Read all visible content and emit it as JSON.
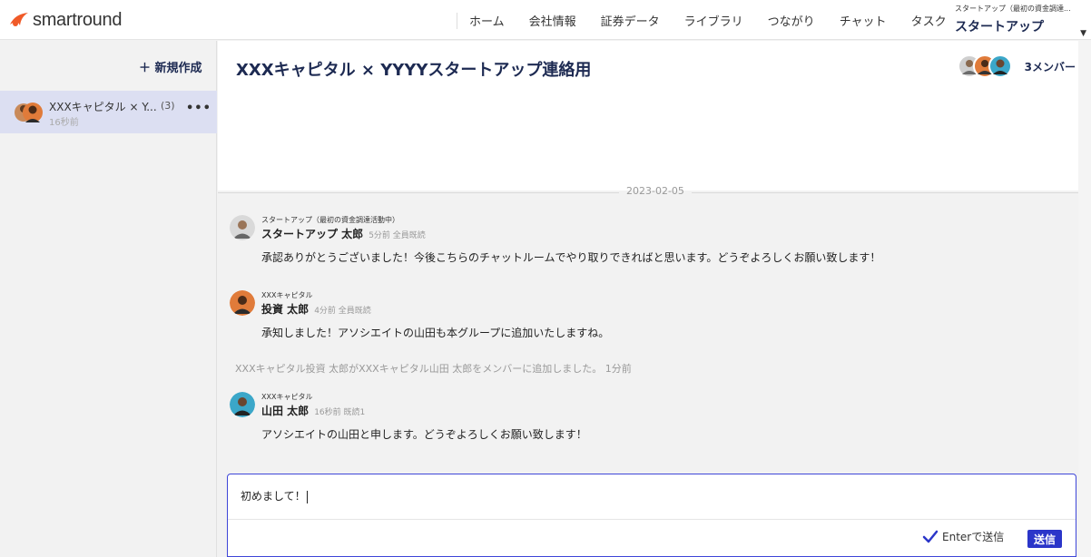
{
  "app": {
    "brand": "smartround",
    "brand_color": "#f05a28",
    "accent_color": "#1d2a52",
    "primary_button_color": "#2b36c9"
  },
  "nav": {
    "items": [
      "ホーム",
      "会社情報",
      "証券データ",
      "ライブラリ",
      "つながり",
      "チャット",
      "タスク"
    ]
  },
  "org_switcher": {
    "subtitle": "スタートアップ（最初の資金調達...",
    "name": "スタートアップ ...",
    "caret_icon": "caret-down-icon"
  },
  "sidebar": {
    "new_label": "新規作成",
    "plus_icon": "plus-icon",
    "rooms": [
      {
        "name": "XXXキャピタル × Y...",
        "count": "(3)",
        "time": "16秒前",
        "more": "•••"
      }
    ]
  },
  "room": {
    "title": "XXXキャピタル × YYYYスタートアップ連絡用",
    "members_label": "3メンバー"
  },
  "messages": {
    "date": "2023-02-05",
    "list": [
      {
        "org": "スタートアップ（最初の資金調達活動中）",
        "sender": "スタートアップ 太郎",
        "meta": "5分前 全員既読",
        "text": "承認ありがとうございました！今後こちらのチャットルームでやり取りできればと思います。どうぞよろしくお願い致します！"
      },
      {
        "org": "XXXキャピタル",
        "sender": "投資 太郎",
        "meta": "4分前 全員既読",
        "text": "承知しました！アソシエイトの山田も本グループに追加いたしますね。"
      },
      {
        "org": "XXXキャピタル",
        "sender": "山田 太郎",
        "meta": "16秒前 既読1",
        "text": "アソシエイトの山田と申します。どうぞよろしくお願い致します！"
      }
    ],
    "system": "XXXキャピタル投資 太郎がXXXキャピタル山田 太郎をメンバーに追加しました。 1分前"
  },
  "composer": {
    "value": "初めまして！",
    "enter_to_send_label": "Enterで送信",
    "enter_to_send_checked": true,
    "send_label": "送信"
  }
}
